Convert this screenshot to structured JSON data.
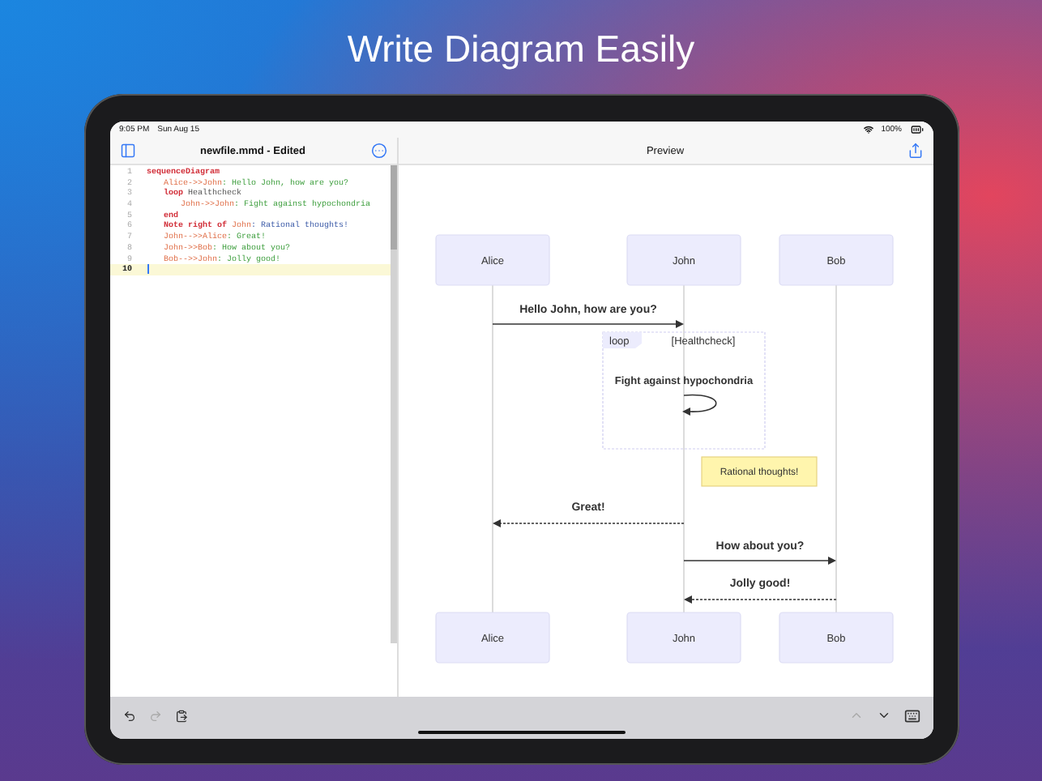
{
  "headline": "Write Diagram Easily",
  "status_bar": {
    "time": "9:05 PM",
    "date": "Sun Aug 15",
    "battery": "100%"
  },
  "editor": {
    "title": "newfile.mmd - Edited",
    "lines": [
      {
        "number": "1",
        "tokens": [
          {
            "kind": "keyword",
            "text": "sequenceDiagram"
          }
        ],
        "children": [
          {
            "number": "2",
            "tokens": [
              {
                "kind": "participant",
                "text": "Alice->>John"
              },
              {
                "kind": "message",
                "text": ": Hello John, how are you?"
              }
            ]
          },
          {
            "number": "3",
            "tokens": [
              {
                "kind": "keyword",
                "text": "loop "
              },
              {
                "kind": "label",
                "text": "Healthcheck"
              }
            ],
            "children": [
              {
                "number": "4",
                "tokens": [
                  {
                    "kind": "participant",
                    "text": "John->>John"
                  },
                  {
                    "kind": "message",
                    "text": ": Fight against hypochondria"
                  }
                ]
              }
            ]
          },
          {
            "number": "5",
            "tokens": [
              {
                "kind": "keyword",
                "text": "end"
              }
            ]
          },
          {
            "number": "6",
            "tokens": [
              {
                "kind": "keyword",
                "text": "Note right of "
              },
              {
                "kind": "participant",
                "text": "John"
              },
              {
                "kind": "note",
                "text": ": Rational thoughts!"
              }
            ]
          },
          {
            "number": "7",
            "tokens": [
              {
                "kind": "participant",
                "text": "John-->>Alice"
              },
              {
                "kind": "message",
                "text": ": Great!"
              }
            ]
          },
          {
            "number": "8",
            "tokens": [
              {
                "kind": "participant",
                "text": "John->>Bob"
              },
              {
                "kind": "message",
                "text": ": How about you?"
              }
            ]
          },
          {
            "number": "9",
            "tokens": [
              {
                "kind": "participant",
                "text": "Bob-->>John"
              },
              {
                "kind": "message",
                "text": ": Jolly good!"
              }
            ]
          }
        ]
      },
      {
        "number": "10",
        "current": true
      }
    ]
  },
  "preview": {
    "title": "Preview",
    "diagram": {
      "participants_top": [
        "Alice",
        "John",
        "Bob"
      ],
      "participants_bottom": [
        "Alice",
        "John",
        "Bob"
      ],
      "messages": [
        {
          "text": "Hello John, how are you?",
          "kind": "solid"
        },
        {
          "text": "Great!",
          "kind": "dashed"
        },
        {
          "text": "How about you?",
          "kind": "solid"
        },
        {
          "text": "Jolly good!",
          "kind": "dashed"
        }
      ],
      "loop": {
        "label": "loop",
        "condition": "[Healthcheck]",
        "message": "Fight against hypochondria"
      },
      "note": "Rational thoughts!"
    }
  }
}
